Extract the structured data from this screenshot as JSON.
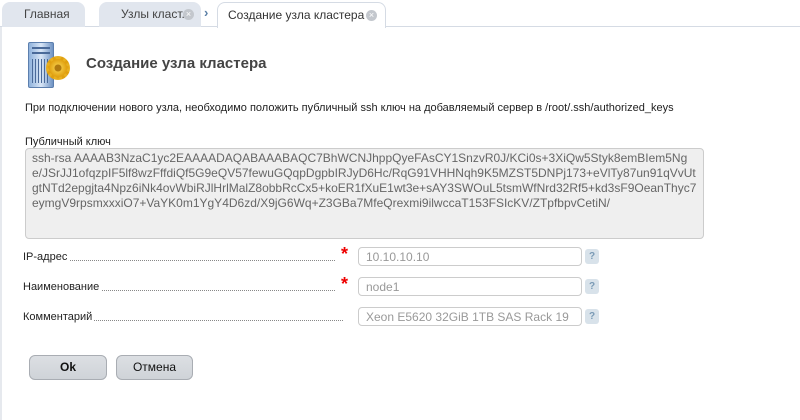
{
  "tabs": [
    {
      "label": "Главная"
    },
    {
      "label": "Узлы класт..."
    },
    {
      "label": "Создание узла кластера"
    }
  ],
  "header": {
    "title": "Создание узла кластера",
    "icon": "server-gear-icon"
  },
  "info": "При подключении нового узла, необходимо положить публичный ssh ключ на добавляемый сервер в /root/.ssh/authorized_keys",
  "key": {
    "label": "Публичный ключ",
    "value": "ssh-rsa AAAAB3NzaC1yc2EAAAADAQABAAABAQC7BhWCNJhppQyeFAsCY1SnzvR0J/KCi0s+3XiQw5Styk8emBIem5Nge/JSrJJ1ofqzpIF5lf8wzFffdiQf5G9eQV57fewuGQqpDgpbIRJyD6Hc/RqG91VHHNqh9K5MZST5DNPj173+eVlTy87un91qVvUtgtNTd2epgjta4Npz6iNk4ovWbiRJlHrlMalZ8obbRcCx5+koER1fXuE1wt3e+sAY3SWOuL5tsmWfNrd32Rf5+kd3sF9OeanThyc7eymgV9rpsmxxxiO7+VaYK0m1YgY4D6zd/X9jG6Wq+Z3GBa7MfeQrexmi9ilwccaT153FSIcKV/ZTpfbpvCetiN/"
  },
  "fields": [
    {
      "label": "IP-адрес",
      "value": "10.10.10.10",
      "required": true
    },
    {
      "label": "Наименование",
      "value": "node1",
      "required": true
    },
    {
      "label": "Комментарий",
      "value": "Xeon E5620 32GiB 1TB SAS Rack 19",
      "required": false
    }
  ],
  "required_mark": "*",
  "help_mark": "?",
  "close_mark": "×",
  "chevron": "›",
  "buttons": {
    "ok": "Ok",
    "cancel": "Отмена"
  }
}
